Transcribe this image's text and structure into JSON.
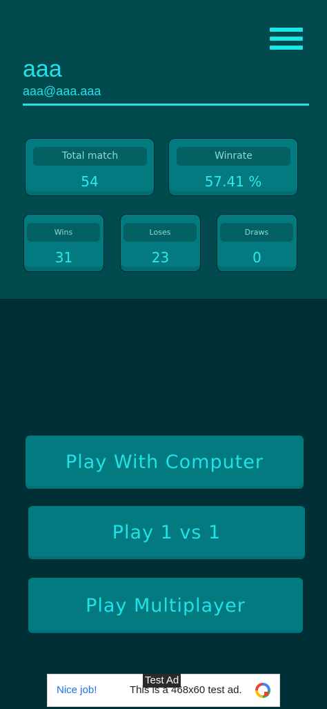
{
  "profile": {
    "name": "aaa",
    "email": "aaa@aaa.aaa"
  },
  "stats": {
    "total_match": {
      "label": "Total match",
      "value": "54"
    },
    "winrate": {
      "label": "Winrate",
      "value": "57.41 %"
    },
    "wins": {
      "label": "Wins",
      "value": "31"
    },
    "loses": {
      "label": "Loses",
      "value": "23"
    },
    "draws": {
      "label": "Draws",
      "value": "0"
    }
  },
  "buttons": {
    "play_computer": "Play With Computer",
    "play_1v1": "Play 1 vs 1",
    "play_multiplayer": "Play Multiplayer"
  },
  "ad": {
    "tag": "Test Ad",
    "nice": "Nice job!",
    "text": "This is a 468x60 test ad."
  },
  "icons": {
    "menu": "hamburger-menu-icon",
    "ad_logo": "ad-choices-icon"
  },
  "colors": {
    "accent": "#1fe3e8",
    "panel": "#024a4e",
    "background": "#012f36",
    "card": "#027a7f"
  }
}
